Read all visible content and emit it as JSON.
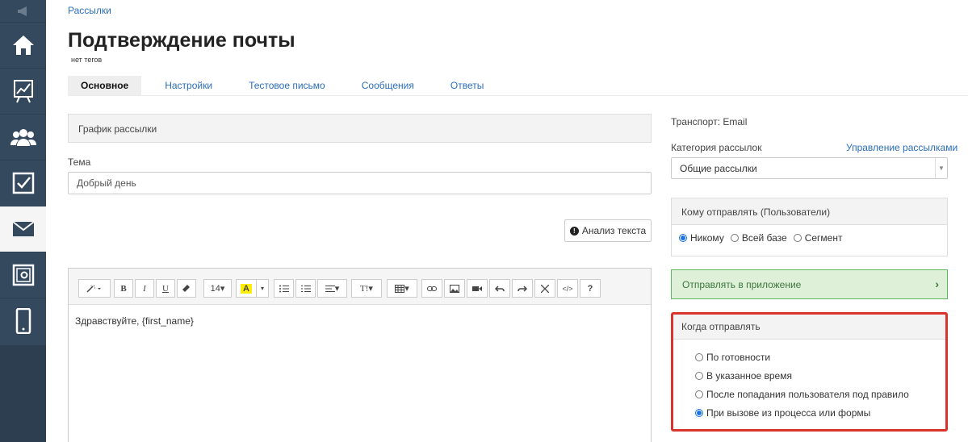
{
  "breadcrumb": "Рассылки",
  "title": "Подтверждение почты",
  "tags_note": "нет тегов",
  "tabs": [
    {
      "label": "Основное",
      "active": true
    },
    {
      "label": "Настройки"
    },
    {
      "label": "Тестовое письмо"
    },
    {
      "label": "Сообщения"
    },
    {
      "label": "Ответы"
    }
  ],
  "schedule_panel": "График рассылки",
  "subject": {
    "label": "Тема",
    "value": "Добрый день"
  },
  "analyze_button": "Анализ текста",
  "editor": {
    "font_size": "14",
    "heading_label": "T",
    "help_label": "?",
    "code_label": "</>",
    "content": "Здравствуйте, {first_name}"
  },
  "transport": "Транспорт: Email",
  "category": {
    "label": "Категория рассылок",
    "manage_link": "Управление рассылками",
    "selected": "Общие рассылки"
  },
  "recipients": {
    "title": "Кому отправлять (Пользователи)",
    "options": [
      "Никому",
      "Всей базе",
      "Сегмент"
    ],
    "selected": "Никому"
  },
  "app_panel": "Отправлять в приложение",
  "when": {
    "title": "Когда отправлять",
    "options": [
      "По готовности",
      "В указанное время",
      "После попадания пользователя под правило",
      "При вызове из процесса или формы"
    ],
    "selected": "При вызове из процесса или формы"
  },
  "colors": {
    "sidebar": "#34495e",
    "link": "#2a6ebb",
    "highlight_border": "#d9342b",
    "success_bg": "#dff0d8"
  }
}
